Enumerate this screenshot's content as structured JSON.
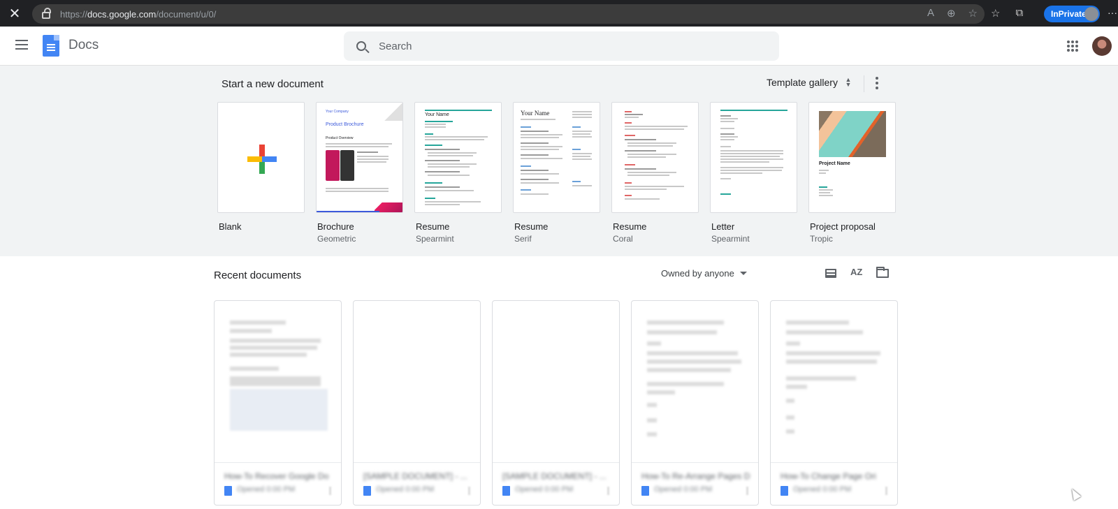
{
  "browser": {
    "url_prefix": "https://",
    "url_domain": "docs.google.com",
    "url_path": "/document/u/0/",
    "inprivate_label": "InPrivate"
  },
  "header": {
    "app_name": "Docs",
    "search_placeholder": "Search"
  },
  "templates_section": {
    "title": "Start a new document",
    "gallery_label": "Template gallery",
    "items": [
      {
        "name": "Blank",
        "sub": ""
      },
      {
        "name": "Brochure",
        "sub": "Geometric"
      },
      {
        "name": "Resume",
        "sub": "Spearmint"
      },
      {
        "name": "Resume",
        "sub": "Serif"
      },
      {
        "name": "Resume",
        "sub": "Coral"
      },
      {
        "name": "Letter",
        "sub": "Spearmint"
      },
      {
        "name": "Project proposal",
        "sub": "Tropic"
      }
    ],
    "thumb_text": {
      "brochure_company": "Your Company",
      "brochure_title": "Product Brochure",
      "brochure_overview": "Product Overview",
      "spearmint_name": "Your Name",
      "serif_name": "Your Name",
      "proposal_title": "Project Name"
    }
  },
  "recent": {
    "title": "Recent documents",
    "owner_filter": "Owned by anyone",
    "sort_label": "AZ",
    "docs": [
      {
        "title": "How-To Recover Google Do",
        "meta": "Opened 0:00 PM"
      },
      {
        "title": "[SAMPLE DOCUMENT] - ...",
        "meta": "Opened 0:00 PM"
      },
      {
        "title": "[SAMPLE DOCUMENT] - ...",
        "meta": "Opened 0:00 PM"
      },
      {
        "title": "How-To Re-Arrange Pages D",
        "meta": "Opened 0:00 PM"
      },
      {
        "title": "How-To Change Page Ori",
        "meta": "Opened 0:00 PM"
      }
    ]
  },
  "colors": {
    "accent": "#1a73e8",
    "docs_blue": "#4285f4",
    "spearmint": "#26a69a",
    "coral": "#e06666"
  }
}
